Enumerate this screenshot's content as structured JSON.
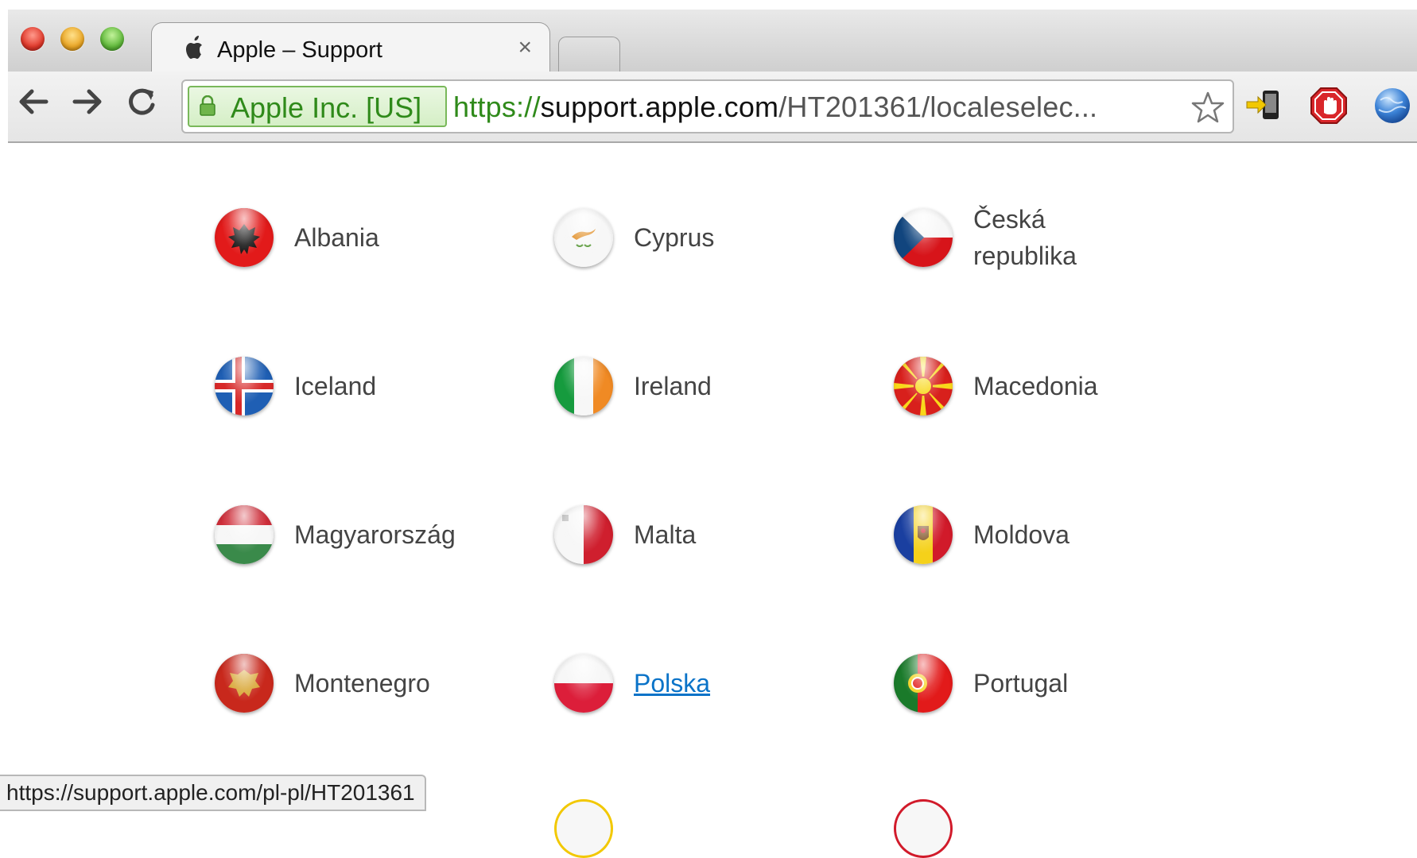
{
  "browser": {
    "tab_title": "Apple – Support",
    "tab_close": "×",
    "ev_label": "Apple Inc. [US]",
    "url_scheme": "https://",
    "url_domain": "support.apple.com",
    "url_path": "/HT201361/localeselec...",
    "status_url": "https://support.apple.com/pl-pl/HT201361"
  },
  "icons": {
    "back": "←",
    "forward": "→",
    "reload": "C",
    "apple": ""
  },
  "countries": [
    {
      "name": "Albania"
    },
    {
      "name": "Cyprus"
    },
    {
      "name": "Česká republika"
    },
    {
      "name": "Iceland"
    },
    {
      "name": "Ireland"
    },
    {
      "name": "Macedonia"
    },
    {
      "name": "Magyarország"
    },
    {
      "name": "Malta"
    },
    {
      "name": "Moldova"
    },
    {
      "name": "Montenegro"
    },
    {
      "name": "Polska"
    },
    {
      "name": "Portugal"
    }
  ],
  "colors": {
    "link": "#0a73c8",
    "ev_green": "#2f8a1a"
  }
}
